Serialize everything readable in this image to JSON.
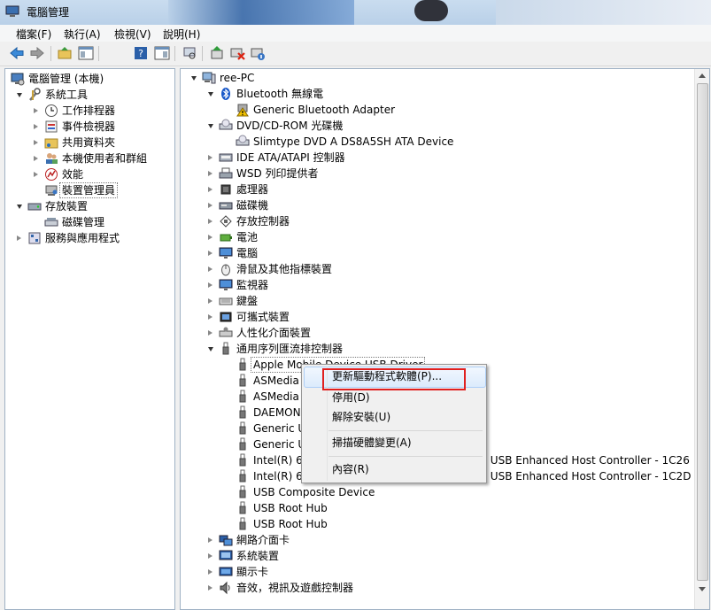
{
  "window": {
    "title": "電腦管理"
  },
  "menu": [
    "檔案(F)",
    "執行(A)",
    "檢視(V)",
    "說明(H)"
  ],
  "toolbar_icons": [
    "back-arrow-icon",
    "forward-arrow-icon",
    "up-folder-icon",
    "show-hide-tree-icon",
    "help-icon",
    "properties-icon",
    "scan-hardware-icon",
    "update-driver-icon",
    "disable-device-icon",
    "uninstall-device-icon"
  ],
  "left_tree": [
    {
      "label": "電腦管理 (本機)",
      "level": 0,
      "expander": "none",
      "icon": "computer-mgmt-icon"
    },
    {
      "label": "系統工具",
      "level": 1,
      "expander": "open",
      "icon": "tools-icon"
    },
    {
      "label": "工作排程器",
      "level": 2,
      "expander": "closed",
      "icon": "clock-icon"
    },
    {
      "label": "事件檢視器",
      "level": 2,
      "expander": "closed",
      "icon": "event-viewer-icon"
    },
    {
      "label": "共用資料夾",
      "level": 2,
      "expander": "closed",
      "icon": "shared-folder-icon"
    },
    {
      "label": "本機使用者和群組",
      "level": 2,
      "expander": "closed",
      "icon": "users-icon"
    },
    {
      "label": "效能",
      "level": 2,
      "expander": "closed",
      "icon": "performance-icon"
    },
    {
      "label": "裝置管理員",
      "level": 2,
      "expander": "none",
      "icon": "device-manager-icon",
      "selected": true
    },
    {
      "label": "存放裝置",
      "level": 1,
      "expander": "open",
      "icon": "storage-icon"
    },
    {
      "label": "磁碟管理",
      "level": 2,
      "expander": "none",
      "icon": "disk-mgmt-icon"
    },
    {
      "label": "服務與應用程式",
      "level": 1,
      "expander": "closed",
      "icon": "services-icon"
    }
  ],
  "device_tree": [
    {
      "label": "ree-PC",
      "level": 0,
      "expander": "open",
      "icon": "computer-icon"
    },
    {
      "label": "Bluetooth 無線電",
      "level": 1,
      "expander": "open",
      "icon": "bluetooth-icon"
    },
    {
      "label": "Generic Bluetooth Adapter",
      "level": 2,
      "expander": "none",
      "icon": "warning-device-icon"
    },
    {
      "label": "DVD/CD-ROM 光碟機",
      "level": 1,
      "expander": "open",
      "icon": "dvd-icon"
    },
    {
      "label": "Slimtype DVD A  DS8A5SH ATA Device",
      "level": 2,
      "expander": "none",
      "icon": "dvd-icon"
    },
    {
      "label": "IDE ATA/ATAPI 控制器",
      "level": 1,
      "expander": "closed",
      "icon": "ide-icon"
    },
    {
      "label": "WSD 列印提供者",
      "level": 1,
      "expander": "closed",
      "icon": "printer-icon"
    },
    {
      "label": "處理器",
      "level": 1,
      "expander": "closed",
      "icon": "processor-icon"
    },
    {
      "label": "磁碟機",
      "level": 1,
      "expander": "closed",
      "icon": "disk-icon"
    },
    {
      "label": "存放控制器",
      "level": 1,
      "expander": "closed",
      "icon": "storage-controller-icon"
    },
    {
      "label": "電池",
      "level": 1,
      "expander": "closed",
      "icon": "battery-icon"
    },
    {
      "label": "電腦",
      "level": 1,
      "expander": "closed",
      "icon": "monitor-icon"
    },
    {
      "label": "滑鼠及其他指標裝置",
      "level": 1,
      "expander": "closed",
      "icon": "mouse-icon"
    },
    {
      "label": "監視器",
      "level": 1,
      "expander": "closed",
      "icon": "monitor-icon"
    },
    {
      "label": "鍵盤",
      "level": 1,
      "expander": "closed",
      "icon": "keyboard-icon"
    },
    {
      "label": "可攜式裝置",
      "level": 1,
      "expander": "closed",
      "icon": "portable-device-icon"
    },
    {
      "label": "人性化介面裝置",
      "level": 1,
      "expander": "closed",
      "icon": "hid-icon"
    },
    {
      "label": "通用序列匯流排控制器",
      "level": 1,
      "expander": "open",
      "icon": "usb-icon"
    },
    {
      "label": "Apple Mobile Device USB Driver",
      "level": 2,
      "expander": "none",
      "icon": "usb-icon",
      "selected": true
    },
    {
      "label": "ASMedia",
      "level": 2,
      "expander": "none",
      "icon": "usb-icon"
    },
    {
      "label": "ASMedia",
      "level": 2,
      "expander": "none",
      "icon": "usb-icon"
    },
    {
      "label": "DAEMON",
      "level": 2,
      "expander": "none",
      "icon": "usb-icon"
    },
    {
      "label": "Generic U",
      "level": 2,
      "expander": "none",
      "icon": "usb-icon"
    },
    {
      "label": "Generic U",
      "level": 2,
      "expander": "none",
      "icon": "usb-icon"
    },
    {
      "label": "Intel(R) 6 Series/C200 Series Chipset Family USB Enhanced Host Controller - 1C26",
      "level": 2,
      "expander": "none",
      "icon": "usb-icon"
    },
    {
      "label": "Intel(R) 6 Series/C200 Series Chipset Family USB Enhanced Host Controller - 1C2D",
      "level": 2,
      "expander": "none",
      "icon": "usb-icon"
    },
    {
      "label": "USB Composite Device",
      "level": 2,
      "expander": "none",
      "icon": "usb-icon"
    },
    {
      "label": "USB Root Hub",
      "level": 2,
      "expander": "none",
      "icon": "usb-icon"
    },
    {
      "label": "USB Root Hub",
      "level": 2,
      "expander": "none",
      "icon": "usb-icon"
    },
    {
      "label": "網路介面卡",
      "level": 1,
      "expander": "closed",
      "icon": "network-icon"
    },
    {
      "label": "系統裝置",
      "level": 1,
      "expander": "closed",
      "icon": "system-device-icon"
    },
    {
      "label": "顯示卡",
      "level": 1,
      "expander": "closed",
      "icon": "display-adapter-icon"
    },
    {
      "label": "音效，視訊及遊戲控制器",
      "level": 1,
      "expander": "closed",
      "icon": "sound-icon"
    }
  ],
  "context_menu": {
    "items": [
      {
        "label": "更新驅動程式軟體(P)...",
        "highlighted": true
      },
      {
        "label": "停用(D)"
      },
      {
        "label": "解除安裝(U)"
      },
      {
        "label": "掃描硬體變更(A)",
        "separator_before": true
      },
      {
        "label": "內容(R)",
        "separator_before": true
      }
    ]
  },
  "colors": {
    "highlight_box": "#e02020",
    "selection": "#cce8ff",
    "tree_line": "#d0d0d0"
  }
}
